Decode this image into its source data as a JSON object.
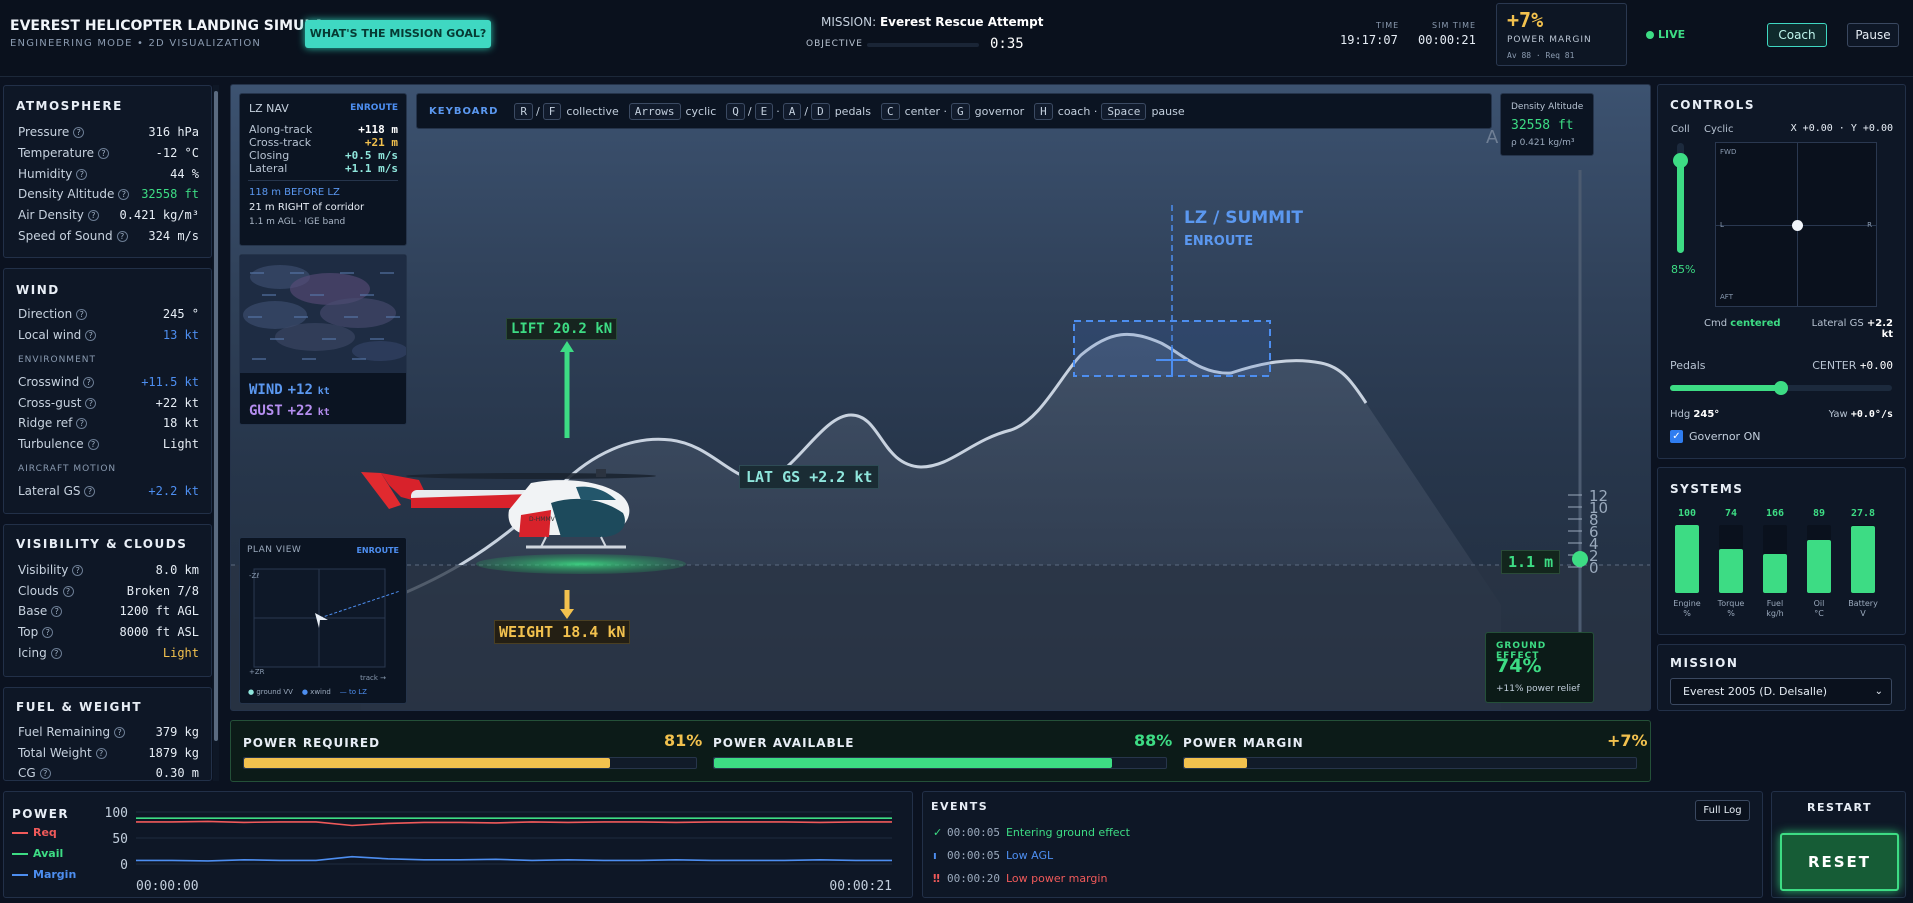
{
  "header": {
    "title": "EVEREST HELICOPTER LANDING SIMULA...",
    "subtitle": "ENGINEERING MODE • 2D VISUALIZATION",
    "goal_button": "WHAT'S THE MISSION GOAL?",
    "mission_label": "MISSION:",
    "mission_name": "Everest Rescue Attempt",
    "objective_label": "OBJECTIVE",
    "objective_time": "0:35",
    "time_label": "TIME",
    "time_value": "19:17:07",
    "simtime_label": "SIM TIME",
    "simtime_value": "00:00:21",
    "power_margin_value": "+7%",
    "power_margin_label": "POWER MARGIN",
    "power_margin_sub": "Av 88 · Req 81",
    "live_label": "LIVE",
    "coach_button": "Coach",
    "pause_button": "Pause"
  },
  "atmosphere": {
    "title": "ATMOSPHERE",
    "rows": [
      {
        "k": "Pressure",
        "v": "316 hPa"
      },
      {
        "k": "Temperature",
        "v": "-12 °C"
      },
      {
        "k": "Humidity",
        "v": "44 %"
      },
      {
        "k": "Density Altitude",
        "v": "32558 ft"
      },
      {
        "k": "Air Density",
        "v": "0.421 kg/m³"
      },
      {
        "k": "Speed of Sound",
        "v": "324 m/s"
      }
    ]
  },
  "wind": {
    "title": "WIND",
    "rows": [
      {
        "k": "Direction",
        "v": "245 °"
      },
      {
        "k": "Local wind",
        "v": "13 kt"
      }
    ],
    "env_label": "ENVIRONMENT",
    "env_rows": [
      {
        "k": "Crosswind",
        "v": "+11.5 kt"
      },
      {
        "k": "Cross-gust",
        "v": "+22 kt"
      },
      {
        "k": "Ridge ref",
        "v": "18 kt"
      },
      {
        "k": "Turbulence",
        "v": "Light"
      }
    ],
    "motion_label": "AIRCRAFT MOTION",
    "motion_rows": [
      {
        "k": "Lateral GS",
        "v": "+2.2 kt"
      }
    ]
  },
  "visibility": {
    "title": "VISIBILITY & CLOUDS",
    "rows": [
      {
        "k": "Visibility",
        "v": "8.0 km"
      },
      {
        "k": "Clouds",
        "v": "Broken 7/8"
      },
      {
        "k": "Base",
        "v": "1200 ft AGL"
      },
      {
        "k": "Top",
        "v": "8000 ft ASL"
      },
      {
        "k": "Icing",
        "v": "Light"
      }
    ]
  },
  "fuel": {
    "title": "FUEL & WEIGHT",
    "rows": [
      {
        "k": "Fuel Remaining",
        "v": "379 kg"
      },
      {
        "k": "Total Weight",
        "v": "1879 kg"
      },
      {
        "k": "CG",
        "v": "0.30 m"
      }
    ]
  },
  "lznav": {
    "title": "LZ NAV",
    "status": "ENROUTE",
    "rows": [
      {
        "k": "Along-track",
        "v": "+118 m"
      },
      {
        "k": "Cross-track",
        "v": "+21 m"
      },
      {
        "k": "Closing",
        "v": "+0.5 m/s"
      },
      {
        "k": "Lateral",
        "v": "+1.1 m/s"
      }
    ],
    "note1": "118 m BEFORE LZ",
    "note2": "21 m RIGHT of corridor",
    "note3": "1.1 m AGL · IGE band"
  },
  "windbox": {
    "wind_label": "WIND",
    "wind_value": "+12",
    "gust_label": "GUST",
    "gust_value": "+22",
    "unit": "kt"
  },
  "planview": {
    "title": "PLAN VIEW",
    "status": "ENROUTE",
    "top_label": "-Zℓ",
    "bottom_label": "+ZR",
    "track_label": "track →",
    "legend": [
      "ground VV",
      "xwind",
      "— to LZ"
    ]
  },
  "keyboard": {
    "title": "KEYBOARD",
    "items": [
      {
        "keys": [
          "R",
          "F"
        ],
        "desc": "collective"
      },
      {
        "keys": [
          "Arrows"
        ],
        "desc": "cyclic"
      },
      {
        "keys": [
          "Q",
          "E",
          "A",
          "D"
        ],
        "desc": "pedals"
      },
      {
        "keys": [
          "C"
        ],
        "desc": "center ·"
      },
      {
        "keys": [
          "G"
        ],
        "desc": "governor"
      },
      {
        "keys": [
          "H"
        ],
        "desc": "coach ·"
      },
      {
        "keys": [
          "Space"
        ],
        "desc": "pause"
      }
    ]
  },
  "density_box": {
    "label": "Density Altitude",
    "value": "32558 ft",
    "sub": "ρ 0.421 kg/m³"
  },
  "scene": {
    "lz_title": "LZ / SUMMIT",
    "lz_status": "ENROUTE",
    "lift_label": "LIFT 20.2 kN",
    "weight_label": "WEIGHT 18.4 kN",
    "latgs_label": "LAT GS +2.2 kt",
    "agl_label": "1.1 m",
    "tail_number": "D-HMMV",
    "scale_ticks": [
      "12",
      "10",
      "8",
      "6",
      "4",
      "2",
      "0"
    ],
    "ghost_letter": "A"
  },
  "ground_effect": {
    "title": "GROUND EFFECT",
    "value": "74%",
    "sub": "+11% power relief"
  },
  "power": {
    "required": {
      "label": "POWER REQUIRED",
      "value": "81%",
      "fill": 81,
      "color": "#f2c14e"
    },
    "available": {
      "label": "POWER AVAILABLE",
      "value": "88%",
      "fill": 88,
      "color": "#3ddc84"
    },
    "margin": {
      "label": "POWER MARGIN",
      "value": "+7%",
      "fill": 14,
      "color": "#f2c14e"
    }
  },
  "controls": {
    "title": "CONTROLS",
    "coll_label": "Coll",
    "cyclic_label": "Cyclic",
    "cyclic_xy": "X +0.00 · Y +0.00",
    "coll_value": "85%",
    "coll_fill": 85,
    "fwd": "FWD",
    "aft": "AFT",
    "l": "L",
    "r": "R",
    "cmd_label": "Cmd",
    "cmd_value": "centered",
    "latgs_label": "Lateral GS",
    "latgs_value": "+2.2",
    "latgs_unit": "kt",
    "pedals_label": "Pedals",
    "pedals_state": "CENTER",
    "pedals_value": "+0.00",
    "hdg_label": "Hdg",
    "hdg_value": "245°",
    "yaw_label": "Yaw",
    "yaw_value": "+0.0°/s",
    "governor_label": "Governor ON"
  },
  "systems": {
    "title": "SYSTEMS",
    "gauges": [
      {
        "value": "100",
        "fill": 100,
        "label1": "Engine",
        "label2": "%"
      },
      {
        "value": "74",
        "fill": 65,
        "label1": "Torque",
        "label2": "%"
      },
      {
        "value": "166",
        "fill": 58,
        "label1": "Fuel",
        "label2": "kg/h"
      },
      {
        "value": "89",
        "fill": 78,
        "label1": "Oil",
        "label2": "°C"
      },
      {
        "value": "27.8",
        "fill": 98,
        "label1": "Battery",
        "label2": "V"
      }
    ]
  },
  "mission": {
    "title": "MISSION",
    "selected": "Everest 2005 (D. Delsalle)"
  },
  "power_chart": {
    "title": "POWER",
    "legend": [
      {
        "name": "Req",
        "color": "#f05a5a"
      },
      {
        "name": "Avail",
        "color": "#3ddc84"
      },
      {
        "name": "Margin",
        "color": "#4d8ef0"
      }
    ],
    "y_ticks": [
      "100",
      "50",
      "0"
    ],
    "x_start": "00:00:00",
    "x_end": "00:00:21"
  },
  "chart_data": {
    "type": "line",
    "ylim": [
      0,
      100
    ],
    "x": [
      0,
      1,
      2,
      3,
      4,
      5,
      6,
      7,
      8,
      9,
      10,
      11,
      12,
      13,
      14,
      15,
      16,
      17,
      18,
      19,
      20,
      21
    ],
    "series": [
      {
        "name": "Req",
        "values": [
          81,
          81,
          82,
          80,
          81,
          81,
          74,
          78,
          80,
          80,
          79,
          81,
          80,
          81,
          81,
          80,
          81,
          81,
          81,
          80,
          81,
          81
        ]
      },
      {
        "name": "Avail",
        "values": [
          88,
          88,
          88,
          88,
          88,
          88,
          88,
          88,
          88,
          88,
          88,
          88,
          88,
          88,
          88,
          88,
          88,
          88,
          88,
          88,
          88,
          88
        ]
      },
      {
        "name": "Margin",
        "values": [
          7,
          7,
          6,
          8,
          7,
          7,
          14,
          10,
          8,
          8,
          9,
          7,
          8,
          7,
          7,
          8,
          7,
          7,
          7,
          8,
          7,
          7
        ]
      }
    ]
  },
  "events": {
    "title": "EVENTS",
    "full_log": "Full Log",
    "items": [
      {
        "icon": "✓",
        "time": "00:00:05",
        "text": "Entering ground effect",
        "color": "#3ddc84"
      },
      {
        "icon": "ı",
        "time": "00:00:05",
        "text": "Low AGL",
        "color": "#4d8ef0"
      },
      {
        "icon": "‼",
        "time": "00:00:20",
        "text": "Low power margin",
        "color": "#f05a5a"
      }
    ]
  },
  "restart": {
    "title": "RESTART",
    "button": "RESET"
  }
}
